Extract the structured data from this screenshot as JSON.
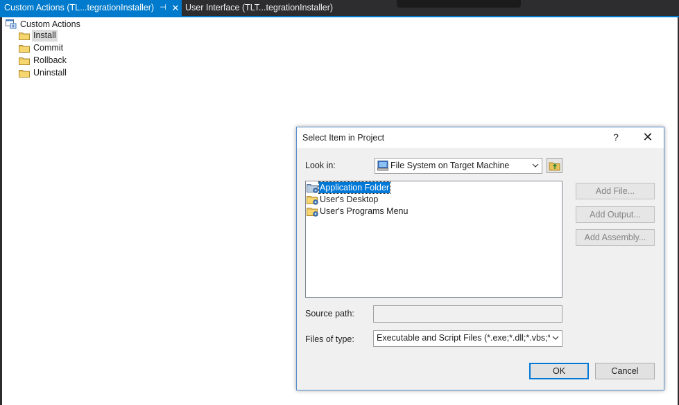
{
  "tabs": {
    "active_title": "Custom Actions (TL...tegrationInstaller)",
    "pin_glyph": "⊣",
    "close_glyph": "✕",
    "inactive_title": "User Interface (TLT...tegrationInstaller)"
  },
  "tree": {
    "root": {
      "label": "Custom Actions",
      "icon": "custom-actions-icon"
    },
    "items": [
      {
        "label": "Install",
        "icon": "folder-icon",
        "selected": true
      },
      {
        "label": "Commit",
        "icon": "folder-icon",
        "selected": false
      },
      {
        "label": "Rollback",
        "icon": "folder-icon",
        "selected": false
      },
      {
        "label": "Uninstall",
        "icon": "folder-icon",
        "selected": false
      }
    ]
  },
  "dialog": {
    "title": "Select Item in Project",
    "help_glyph": "?",
    "close_glyph": "✕",
    "look_in_label": "Look in:",
    "look_in_value": "File System on Target Machine",
    "list_items": [
      {
        "label": "Application Folder",
        "icon": "application-folder-icon",
        "selected": true
      },
      {
        "label": "User's Desktop",
        "icon": "special-folder-icon",
        "selected": false
      },
      {
        "label": "User's Programs Menu",
        "icon": "special-folder-icon",
        "selected": false
      }
    ],
    "side_buttons": {
      "add_file": "Add File...",
      "add_output": "Add Output...",
      "add_assembly": "Add Assembly..."
    },
    "source_path_label": "Source path:",
    "source_path_value": "",
    "files_of_type_label": "Files of type:",
    "files_of_type_value": "Executable and Script Files (*.exe;*.dll;*.vbs;*.",
    "ok_label": "OK",
    "cancel_label": "Cancel"
  },
  "colors": {
    "accent": "#007acc",
    "selection": "#0078d7",
    "tab_bar": "#2d2d30",
    "disabled_text": "#838383"
  }
}
